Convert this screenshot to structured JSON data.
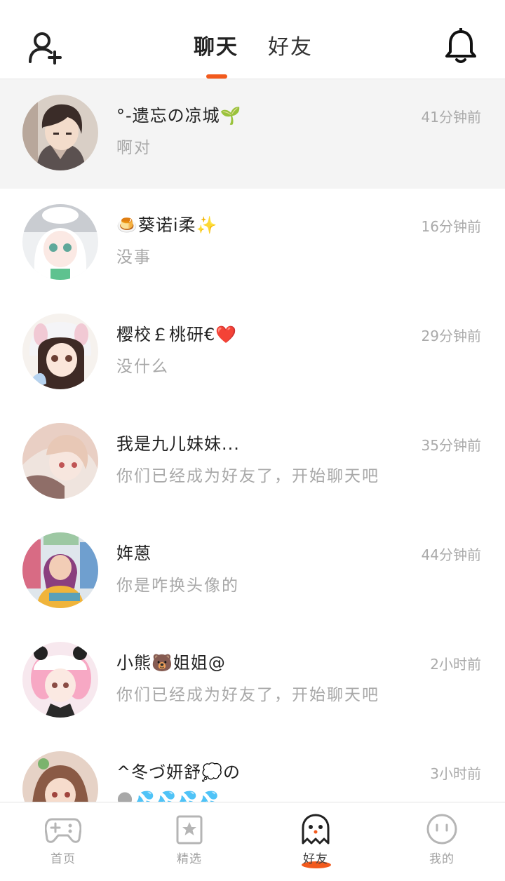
{
  "header": {
    "tabs": [
      {
        "label": "聊天"
      },
      {
        "label": "好友"
      }
    ]
  },
  "chats": [
    {
      "name": "°-遗忘の凉城🌱",
      "message": "啊对",
      "time": "41分钟前"
    },
    {
      "name": "🍮葵诺i柔✨",
      "message": "没事",
      "time": "16分钟前"
    },
    {
      "name": "樱校￡桃研€❤️",
      "message": "没什么",
      "time": "29分钟前"
    },
    {
      "name": "我是九儿妹妹...",
      "message": "你们已经成为好友了，开始聊天吧",
      "time": "35分钟前"
    },
    {
      "name": "姩蒽",
      "message": "你是咋换头像的",
      "time": "44分钟前"
    },
    {
      "name": "小熊🐻姐姐@",
      "message": "你们已经成为好友了，开始聊天吧",
      "time": "2小时前"
    },
    {
      "name": "^冬づ妍舒💭の",
      "message": "🌑💦💦💦💦",
      "time": "3小时前"
    }
  ],
  "tabbar": [
    {
      "label": "首页",
      "icon": "gamepad-icon"
    },
    {
      "label": "精选",
      "icon": "star-icon"
    },
    {
      "label": "好友",
      "icon": "ghost-icon"
    },
    {
      "label": "我的",
      "icon": "face-icon"
    }
  ],
  "colors": {
    "accent": "#f25a1d",
    "active_row_bg": "#f4f4f4",
    "secondary_text": "#a8a8a8"
  }
}
